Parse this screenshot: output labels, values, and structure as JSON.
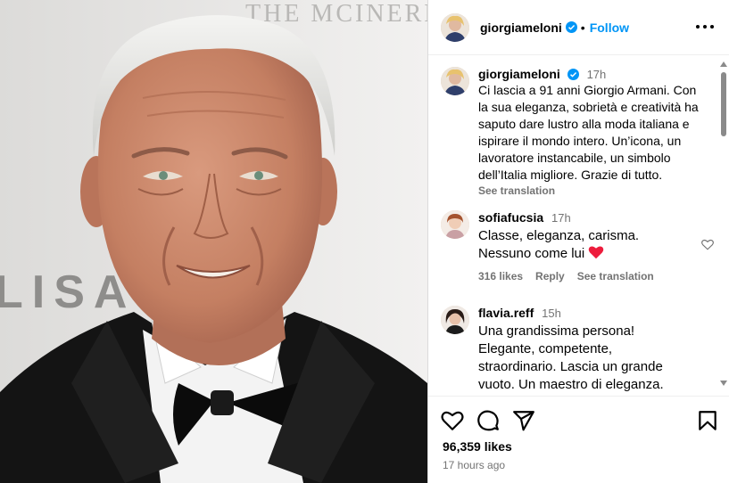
{
  "photo": {
    "background_text": "THE MCINERNEY",
    "side_text": "LISA"
  },
  "header": {
    "username": "giorgiameloni",
    "separator": "•",
    "follow_label": "Follow"
  },
  "caption": {
    "username": "giorgiameloni",
    "time": "17h",
    "lines": [
      "Ci lascia a 91 anni Giorgio Armani. Con",
      "la sua eleganza, sobrietà e creatività ha",
      "saputo dare lustro alla moda italiana e",
      "ispirare il mondo intero. Un’icona, un",
      "lavoratore instancabile, un simbolo",
      "dell’Italia migliore. Grazie di tutto."
    ],
    "see_translation": "See translation"
  },
  "comments": [
    {
      "username": "sofiafucsia",
      "time": "17h",
      "lines": [
        "Classe, eleganza, carisma.",
        "Nessuno come lui"
      ],
      "likes": "316 likes",
      "reply": "Reply",
      "see_translation": "See translation"
    },
    {
      "username": "flavia.reff",
      "time": "15h",
      "lines": [
        "Una grandissima persona!",
        "Elegante, competente,",
        "straordinario. Lascia un grande",
        "vuoto. Un maestro di eleganza."
      ]
    }
  ],
  "footer": {
    "likes": "96,359 likes",
    "posted": "17 hours ago"
  },
  "colors": {
    "accent": "#0095f6",
    "muted": "#737373",
    "heart": "#ed1c3c"
  },
  "icons": [
    "verified-badge-icon",
    "more-options-icon",
    "heart-icon",
    "comment-icon",
    "share-icon",
    "bookmark-icon"
  ]
}
